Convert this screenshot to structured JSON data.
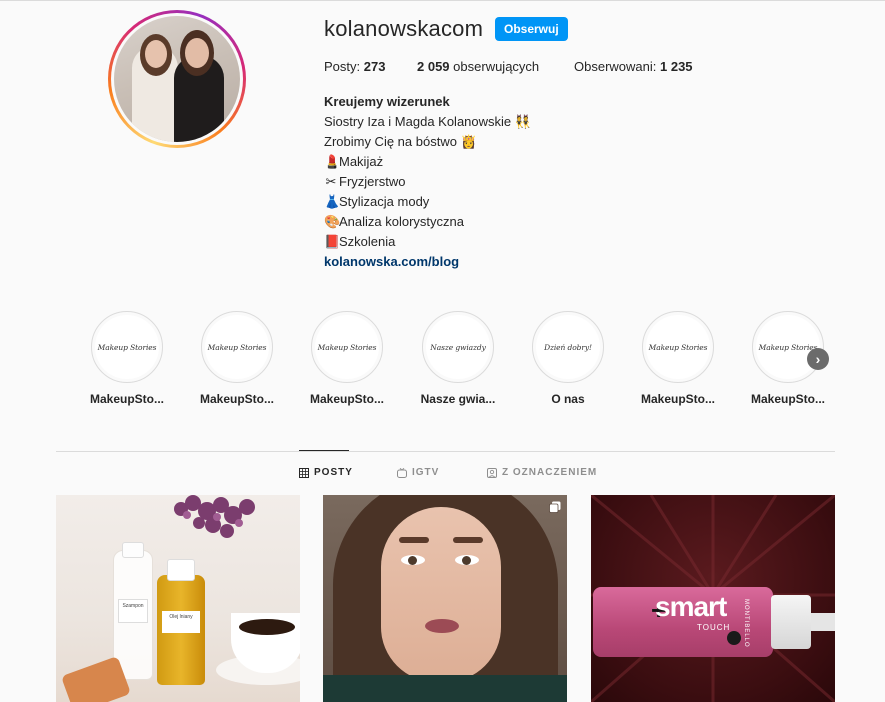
{
  "profile": {
    "username": "kolanowskacom",
    "follow_label": "Obserwuj",
    "stats": {
      "posts_label": "Posty:",
      "posts_value": "273",
      "followers_value": "2 059",
      "followers_label": "obserwujących",
      "following_label": "Obserwowani:",
      "following_value": "1 235"
    },
    "bio": {
      "name": "Kreujemy wizerunek",
      "lines": [
        {
          "text": "Siostry Iza i Magda Kolanowskie",
          "emoji": "👯"
        },
        {
          "text": "Zrobimy Cię na bóstwo",
          "emoji": "👸"
        }
      ],
      "services": [
        {
          "emoji": "💄",
          "text": "Makijaż"
        },
        {
          "emoji": "✂",
          "text": "Fryzjerstwo"
        },
        {
          "emoji": "👗",
          "text": "Stylizacja mody"
        },
        {
          "emoji": "🎨",
          "text": "Analiza kolorystyczna"
        },
        {
          "emoji": "📕",
          "text": "Szkolenia"
        }
      ],
      "link": "kolanowska.com/blog"
    }
  },
  "highlights": [
    {
      "label": "MakeupSto...",
      "cover_text": "Makeup Stories"
    },
    {
      "label": "MakeupSto...",
      "cover_text": "Makeup Stories"
    },
    {
      "label": "MakeupSto...",
      "cover_text": "Makeup Stories"
    },
    {
      "label": "Nasze gwia...",
      "cover_text": "Nasze gwiazdy"
    },
    {
      "label": "O nas",
      "cover_text": "Dzień dobry!"
    },
    {
      "label": "MakeupSto...",
      "cover_text": "Makeup Stories"
    },
    {
      "label": "MakeupSto...",
      "cover_text": "Makeup Stories"
    }
  ],
  "tabs": [
    {
      "label": "POSTY",
      "icon": "grid-icon",
      "active": true
    },
    {
      "label": "IGTV",
      "icon": "igtv-icon",
      "active": false
    },
    {
      "label": "Z OZNACZENIEM",
      "icon": "tagged-icon",
      "active": false
    }
  ],
  "posts": [
    {
      "labels": [
        "Szampon",
        "Olej lniany"
      ]
    },
    {
      "labels": []
    },
    {
      "labels": [
        "smart",
        "TOUCH",
        "MONTIBELLO"
      ]
    }
  ],
  "colors": {
    "accent": "#0095f6",
    "link": "#00376b",
    "text": "#262626",
    "muted": "#8e8e8e",
    "background": "#fafafa",
    "border": "#dbdbdb"
  }
}
